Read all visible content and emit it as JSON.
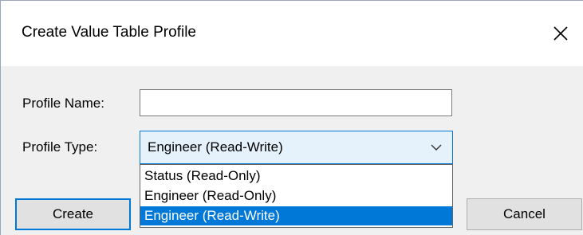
{
  "dialog": {
    "title": "Create Value Table Profile",
    "close_glyph": "close-icon"
  },
  "form": {
    "profile_name_label": "Profile Name:",
    "profile_name_value": "",
    "profile_type_label": "Profile Type:",
    "profile_type_selected": "Engineer (Read-Write)"
  },
  "dropdown": {
    "options": [
      {
        "label": "Status (Read-Only)",
        "selected": false
      },
      {
        "label": "Engineer (Read-Only)",
        "selected": false
      },
      {
        "label": "Engineer (Read-Write)",
        "selected": true
      }
    ]
  },
  "buttons": {
    "create_label": "Create",
    "cancel_label": "Cancel"
  },
  "colors": {
    "accent": "#0078d7",
    "combo_bg": "#e5f1fb",
    "dialog_bg": "#f0f0f0"
  }
}
